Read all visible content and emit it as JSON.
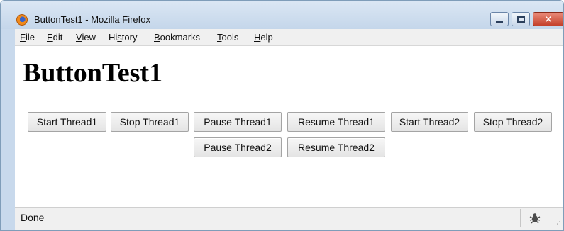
{
  "window": {
    "title": "ButtonTest1 - Mozilla Firefox",
    "minimize_icon": "minimize-icon",
    "maximize_icon": "maximize-icon",
    "close_icon": "close-icon",
    "close_glyph": "✕"
  },
  "menubar": {
    "items": [
      {
        "label": "File",
        "accel": "F"
      },
      {
        "label": "Edit",
        "accel": "E"
      },
      {
        "label": "View",
        "accel": "V"
      },
      {
        "label": "History",
        "accel": "s"
      },
      {
        "label": "Bookmarks",
        "accel": "B"
      },
      {
        "label": "Tools",
        "accel": "T"
      },
      {
        "label": "Help",
        "accel": "H"
      }
    ]
  },
  "page": {
    "heading": "ButtonTest1",
    "buttons": {
      "start_thread1": "Start Thread1",
      "stop_thread1": "Stop Thread1",
      "pause_thread1": "Pause Thread1",
      "resume_thread1": "Resume Thread1",
      "start_thread2": "Start Thread2",
      "stop_thread2": "Stop Thread2",
      "pause_thread2": "Pause Thread2",
      "resume_thread2": "Resume Thread2"
    }
  },
  "statusbar": {
    "text": "Done",
    "icon": "bug-icon"
  },
  "colors": {
    "titlebar": "#c4d6ea",
    "close_button": "#c4402a",
    "menubar": "#f0f0f0"
  }
}
